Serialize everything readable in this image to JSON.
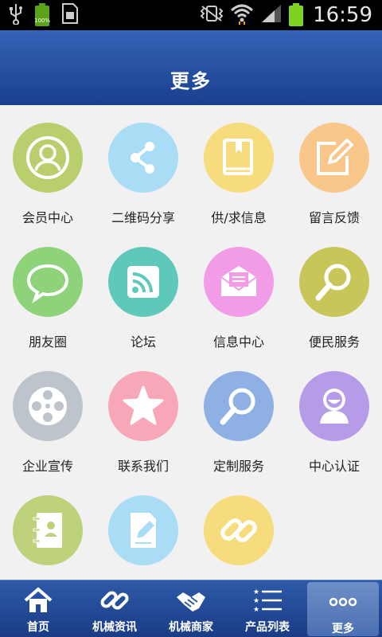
{
  "status_bar": {
    "time": "16:59",
    "battery_small_label": "100%",
    "icons": [
      "usb-icon",
      "battery-small-icon",
      "sim-card-icon",
      "vibrate-icon",
      "wifi-icon",
      "signal-icon",
      "battery-icon"
    ]
  },
  "header": {
    "title": "更多"
  },
  "grid": {
    "items": [
      {
        "label": "会员中心",
        "icon": "member-icon",
        "color": "#b9cf6e"
      },
      {
        "label": "二维码分享",
        "icon": "share-icon",
        "color": "#a9dcf5"
      },
      {
        "label": "供/求信息",
        "icon": "book-icon",
        "color": "#f7dc7e"
      },
      {
        "label": "留言反馈",
        "icon": "edit-icon",
        "color": "#f9c78a"
      },
      {
        "label": "朋友圈",
        "icon": "chat-bubble-icon",
        "color": "#8ed27a"
      },
      {
        "label": "论坛",
        "icon": "rss-icon",
        "color": "#5ec9bb"
      },
      {
        "label": "信息中心",
        "icon": "envelope-icon",
        "color": "#f29be6"
      },
      {
        "label": "便民服务",
        "icon": "magnifier-icon",
        "color": "#c8c659"
      },
      {
        "label": "企业宣传",
        "icon": "film-reel-icon",
        "color": "#bec4cb"
      },
      {
        "label": "联系我们",
        "icon": "star-icon",
        "color": "#f7a7b7"
      },
      {
        "label": "定制服务",
        "icon": "search-icon",
        "color": "#8fb0e3"
      },
      {
        "label": "中心认证",
        "icon": "user-icon",
        "color": "#b69be8"
      },
      {
        "label": "",
        "icon": "contact-book-icon",
        "color": "#bdd27b"
      },
      {
        "label": "",
        "icon": "document-edit-icon",
        "color": "#a9dcf5"
      },
      {
        "label": "",
        "icon": "link-icon",
        "color": "#f7dc7e"
      }
    ]
  },
  "nav": {
    "items": [
      {
        "label": "首页",
        "icon": "home-icon"
      },
      {
        "label": "机械资讯",
        "icon": "link-icon"
      },
      {
        "label": "机械商家",
        "icon": "handshake-icon"
      },
      {
        "label": "产品列表",
        "icon": "list-icon"
      },
      {
        "label": "更多",
        "icon": "more-icon"
      }
    ],
    "active_index": 4
  }
}
